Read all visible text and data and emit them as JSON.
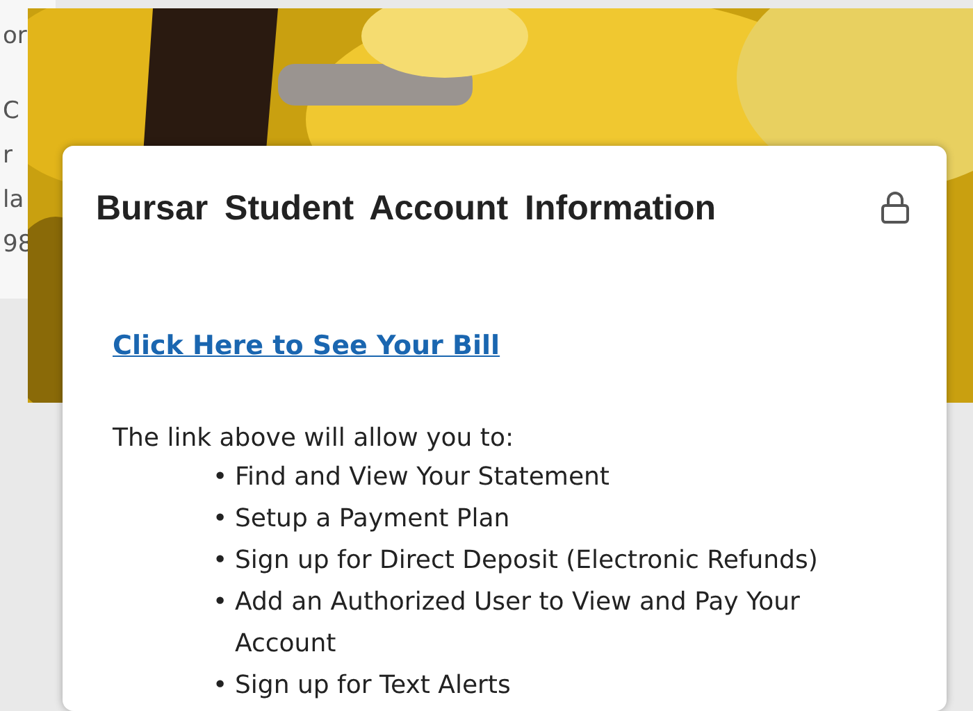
{
  "background_page": {
    "fragments": [
      "or",
      "C",
      "r",
      "la",
      "98"
    ]
  },
  "card": {
    "title": "Bursar Student Account Information",
    "locked": true,
    "link": "Click Here to See Your Bill",
    "intro": "The link above will allow you to:",
    "bullet": "•",
    "items": [
      "Find and View Your Statement",
      "Setup a Payment Plan",
      "Sign up for Direct Deposit (Electronic Refunds)",
      "Add an Authorized User to View and Pay Your Account",
      "Sign up for Text Alerts"
    ]
  }
}
